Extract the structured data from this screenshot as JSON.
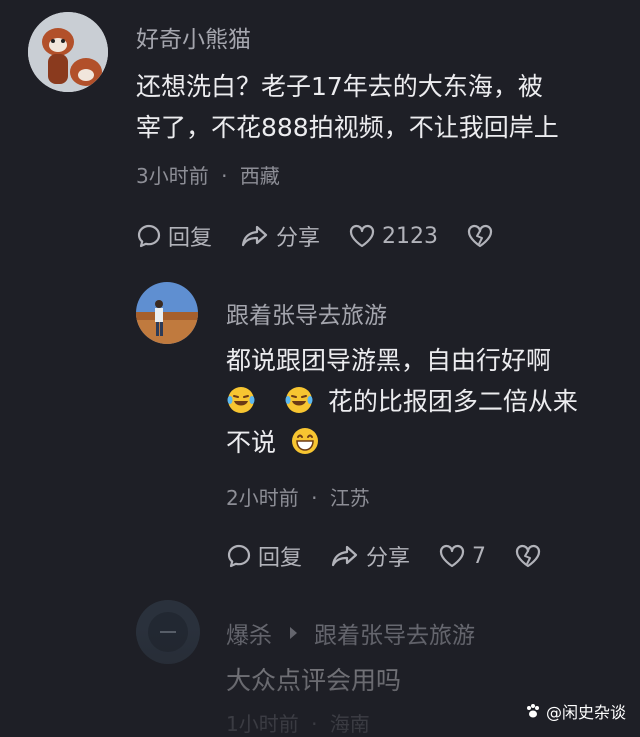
{
  "comment1": {
    "username": "好奇小熊猫",
    "text_line1": "还想洗白？老子17年去的大东海，被",
    "text_line2": "宰了，不花888拍视频，不让我回岸上",
    "time": "3小时前",
    "location": "西藏",
    "reply_label": "回复",
    "share_label": "分享",
    "like_count": "2123"
  },
  "comment2": {
    "username": "跟着张导去旅游",
    "text_line1": "都说跟团导游黑，自由行好啊",
    "text_line2": "花的比报团多二倍从来",
    "text_line3": "不说",
    "time": "2小时前",
    "location": "江苏",
    "reply_label": "回复",
    "share_label": "分享",
    "like_count": "7"
  },
  "comment3": {
    "username": "爆杀",
    "reply_to": "跟着张导去旅游",
    "text": "大众点评会用吗",
    "time": "1小时前",
    "location": "海南"
  },
  "meta_separator": "·",
  "watermark": "@闲史杂谈",
  "colors": {
    "background": "#1e1f26",
    "text": "#ececef",
    "muted": "#8d8e96"
  }
}
